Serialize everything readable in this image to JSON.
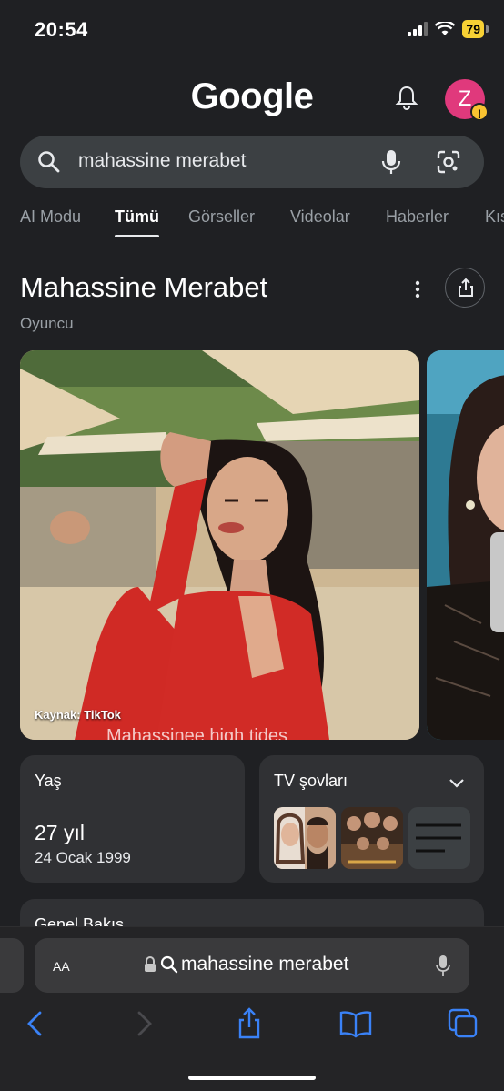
{
  "status": {
    "time": "20:54",
    "battery": "79"
  },
  "header": {
    "logo": "Google",
    "avatar_letter": "Z",
    "avatar_badge": "!"
  },
  "search": {
    "query": "mahassine merabet"
  },
  "tabs": [
    {
      "label": "AI Modu"
    },
    {
      "label": "Tümü"
    },
    {
      "label": "Görseller"
    },
    {
      "label": "Videolar"
    },
    {
      "label": "Haberler"
    },
    {
      "label": "Kıs"
    }
  ],
  "entity": {
    "title": "Mahassine Merabet",
    "subtitle": "Oyuncu",
    "photo_caption": "Kaynak: TikTok",
    "photo_overlay_text": "Mahassinee high tides"
  },
  "cards": {
    "age": {
      "label": "Yaş",
      "value": "27 yıl",
      "date": "24 Ocak 1999"
    },
    "tv": {
      "label": "TV şovları"
    },
    "overview": {
      "label": "Genel Bakış"
    }
  },
  "browser": {
    "aa_label": "AA",
    "address": "mahassine merabet"
  },
  "colors": {
    "background": "#1f2023",
    "card": "#303134",
    "accent_blue": "#3a82f7",
    "avatar": "#e0397c",
    "battery": "#f7d134"
  }
}
